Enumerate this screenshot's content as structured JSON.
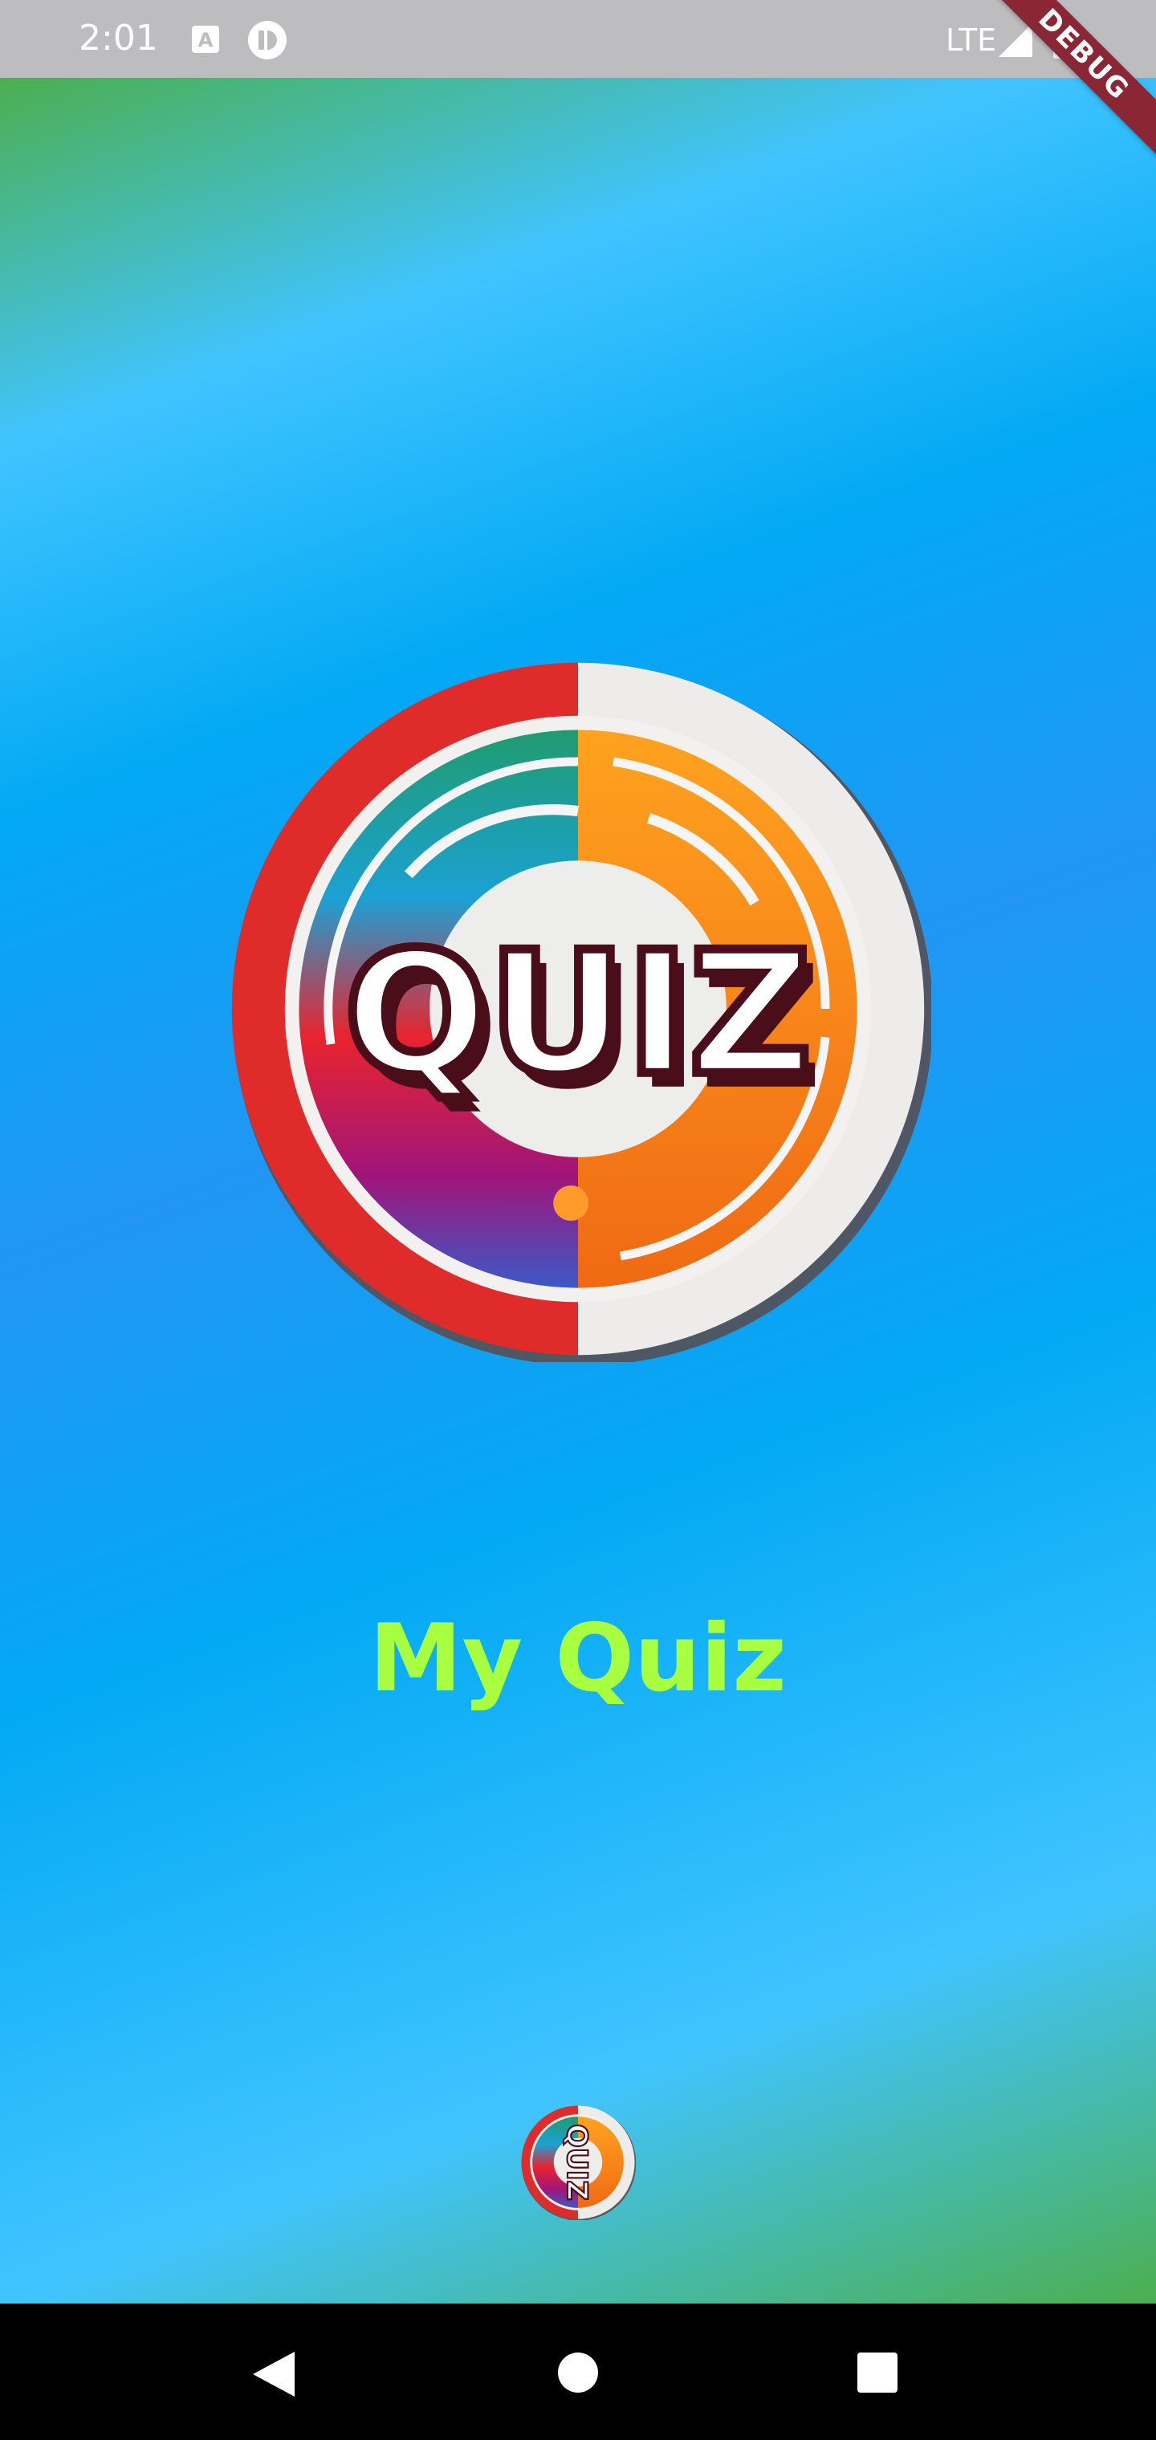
{
  "status_bar": {
    "time": "2:01",
    "network": "LTE",
    "icons": [
      "keyboard-a-icon",
      "app-notification-icon",
      "signal-icon",
      "battery-icon"
    ]
  },
  "debug_banner": {
    "label": "DEBUG"
  },
  "splash": {
    "title": "My Quiz",
    "logo_text": "QUIZ",
    "colors": {
      "title": "#a7ff3f",
      "gradient_green": "#4caf50",
      "gradient_light_blue": "#40c4ff",
      "gradient_blue": "#2196f3"
    }
  },
  "nav_bar": {
    "buttons": [
      "back-icon",
      "home-icon",
      "recents-icon"
    ]
  }
}
